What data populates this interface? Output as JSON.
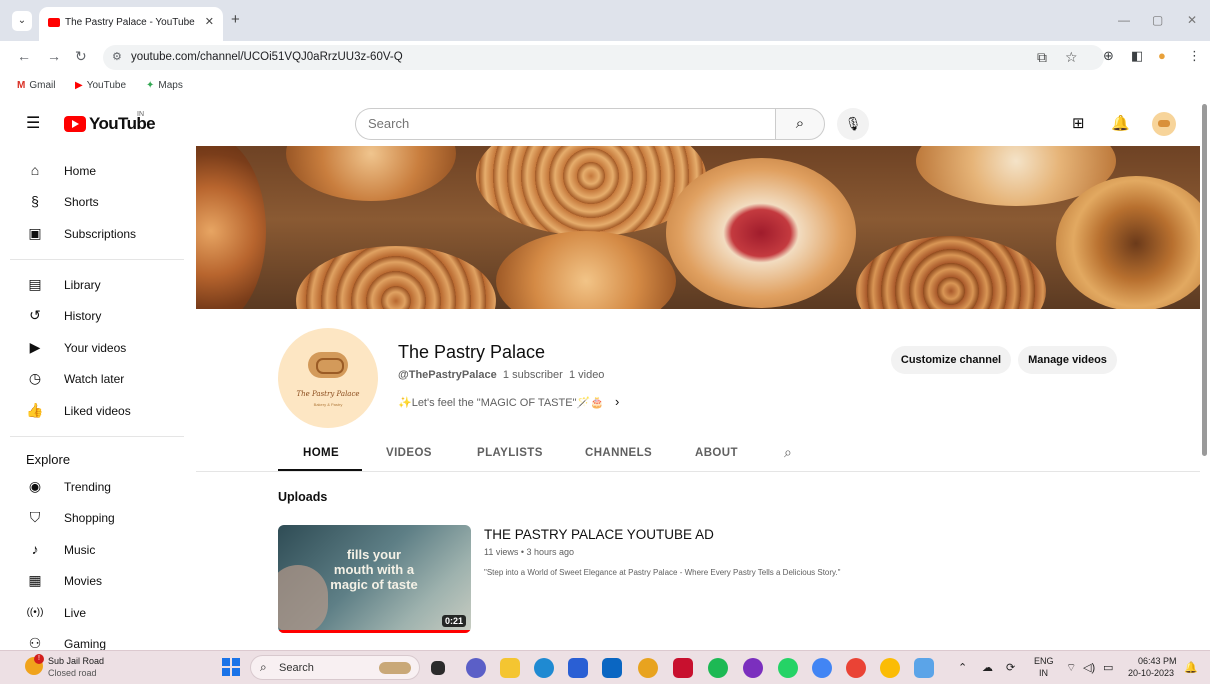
{
  "browser": {
    "tab_title": "The Pastry Palace - YouTube",
    "tab_close": "✕",
    "new_tab": "+",
    "url": "youtube.com/channel/UCOi51VQJ0aRrzUU3z-60V-Q",
    "bookmarks": [
      {
        "label": "Gmail",
        "icon": "gmail-icon"
      },
      {
        "label": "YouTube",
        "icon": "youtube-icon"
      },
      {
        "label": "Maps",
        "icon": "maps-icon"
      }
    ]
  },
  "youtube": {
    "logo_text": "YouTube",
    "country_code": "IN",
    "search_placeholder": "Search"
  },
  "sidebar": {
    "main": [
      {
        "label": "Home",
        "icon": "home-icon"
      },
      {
        "label": "Shorts",
        "icon": "shorts-icon"
      },
      {
        "label": "Subscriptions",
        "icon": "subscriptions-icon"
      }
    ],
    "library": [
      {
        "label": "Library",
        "icon": "library-icon"
      },
      {
        "label": "History",
        "icon": "history-icon"
      },
      {
        "label": "Your videos",
        "icon": "your-videos-icon"
      },
      {
        "label": "Watch later",
        "icon": "watch-later-icon"
      },
      {
        "label": "Liked videos",
        "icon": "liked-videos-icon"
      }
    ],
    "explore_heading": "Explore",
    "explore": [
      {
        "label": "Trending",
        "icon": "trending-icon"
      },
      {
        "label": "Shopping",
        "icon": "shopping-icon"
      },
      {
        "label": "Music",
        "icon": "music-icon"
      },
      {
        "label": "Movies",
        "icon": "movies-icon"
      },
      {
        "label": "Live",
        "icon": "live-icon"
      },
      {
        "label": "Gaming",
        "icon": "gaming-icon"
      }
    ]
  },
  "channel": {
    "name": "The Pastry Palace",
    "handle": "@ThePastryPalace",
    "subscribers": "1 subscriber",
    "videos": "1 video",
    "description": "✨Let's feel the \"MAGIC OF TASTE\"🪄🎂",
    "more": "›",
    "avatar_name": "The Pastry Palace",
    "avatar_sub": "Bakery & Pastry",
    "customize_label": "Customize channel",
    "manage_label": "Manage videos",
    "tabs": [
      "HOME",
      "VIDEOS",
      "PLAYLISTS",
      "CHANNELS",
      "ABOUT"
    ],
    "active_tab": "HOME"
  },
  "uploads": {
    "heading": "Uploads",
    "video": {
      "title": "THE PASTRY PALACE YOUTUBE AD",
      "meta": "11 views • 3 hours ago",
      "description": "\"Step into a World of Sweet Elegance at Pastry Palace - Where Every Pastry Tells a Delicious Story.\"",
      "thumb_text": "fills your mouth with a magic of taste",
      "duration": "0:21"
    }
  },
  "taskbar": {
    "weather_line1": "Sub Jail Road",
    "weather_line2": "Closed road",
    "weather_badge": "!",
    "search_label": "Search",
    "lang1": "ENG",
    "lang2": "IN",
    "time": "06:43 PM",
    "date": "20-10-2023"
  },
  "colors": {
    "accent": "#ff0000",
    "banner": "#7a4b28",
    "taskbar": "#ede0e4"
  }
}
